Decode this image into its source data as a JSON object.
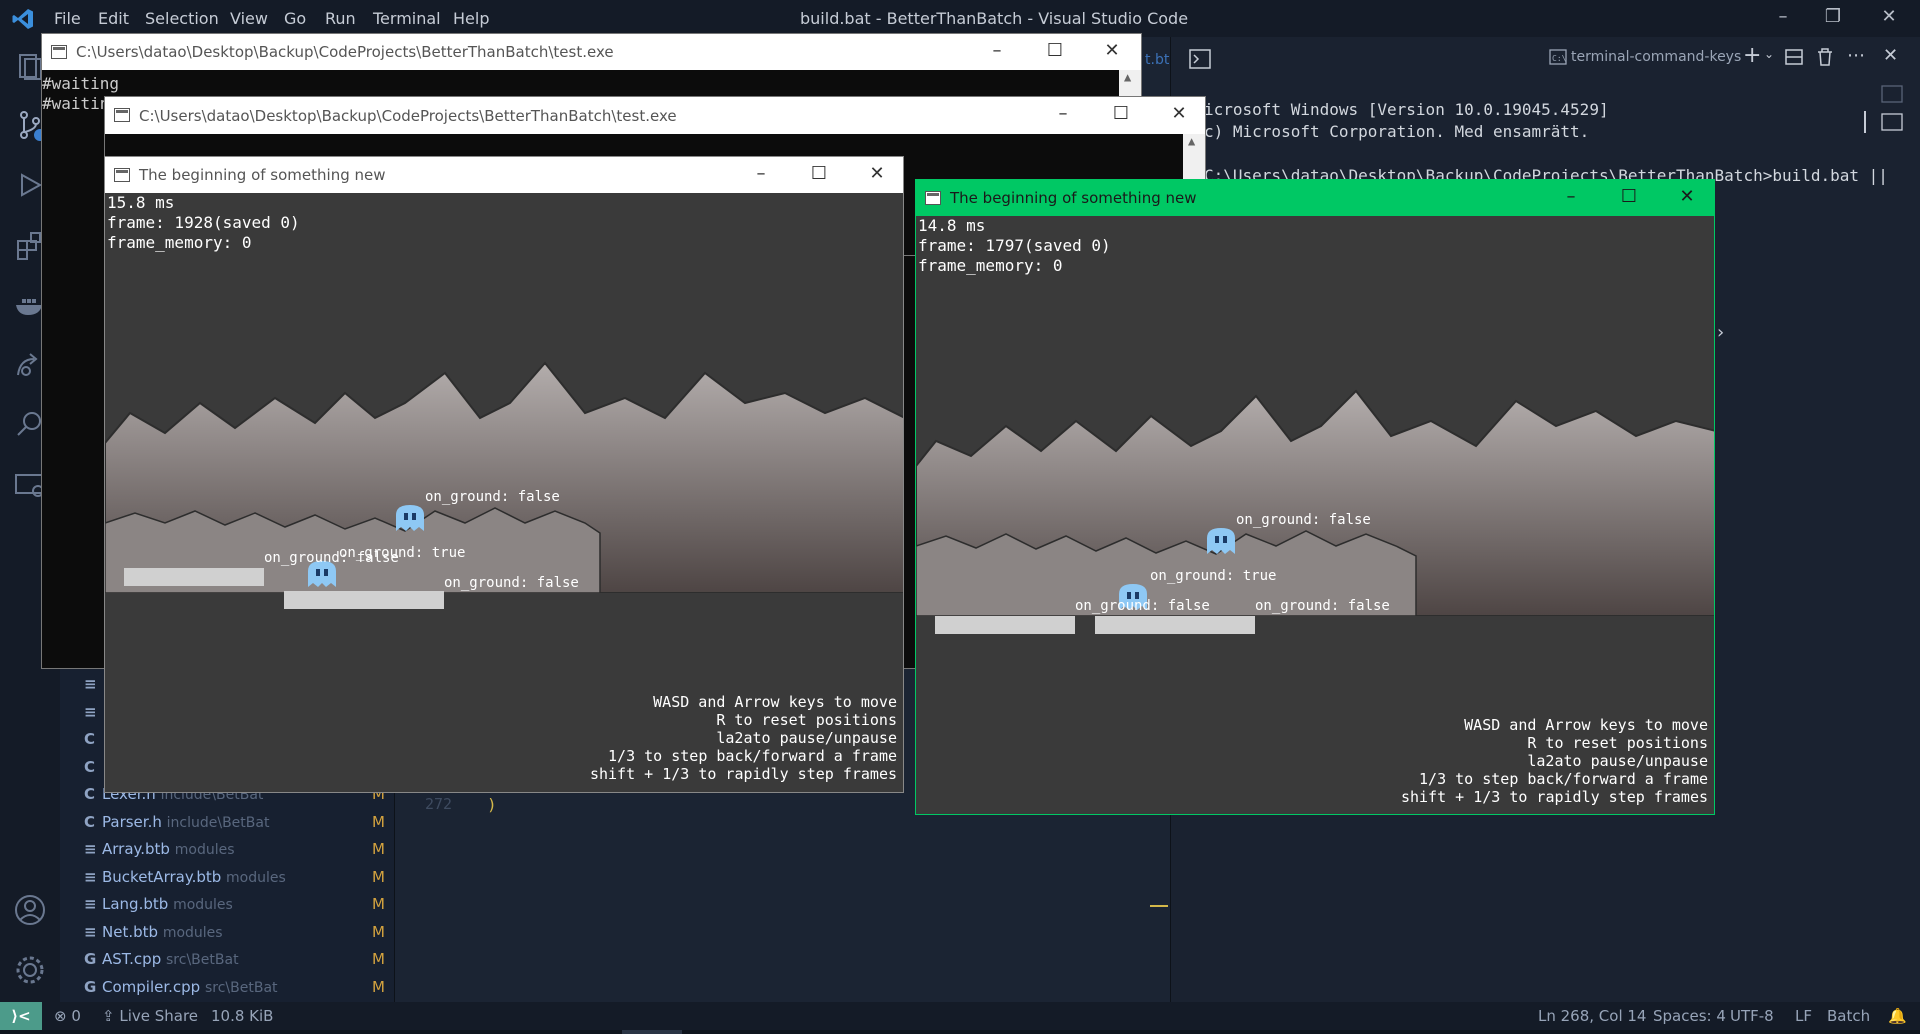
{
  "vscode": {
    "menu": [
      "File",
      "Edit",
      "Selection",
      "View",
      "Go",
      "Run",
      "Terminal",
      "Help"
    ],
    "title": "build.bat - BetterThanBatch - Visual Studio Code",
    "explorer": [
      {
        "icon": "≡",
        "name": "",
        "path": "",
        "mod": ""
      },
      {
        "icon": "≡",
        "name": "",
        "path": "",
        "mod": ""
      },
      {
        "icon": "C",
        "name": "",
        "path": "",
        "mod": ""
      },
      {
        "icon": "C",
        "name": "",
        "path": "",
        "mod": ""
      },
      {
        "icon": "C",
        "name": "Lexer.h",
        "path": "include\\BetBat",
        "mod": "M"
      },
      {
        "icon": "C",
        "name": "Parser.h",
        "path": "include\\BetBat",
        "mod": "M"
      },
      {
        "icon": "≡",
        "name": "Array.btb",
        "path": "modules",
        "mod": "M"
      },
      {
        "icon": "≡",
        "name": "BucketArray.btb",
        "path": "modules",
        "mod": "M"
      },
      {
        "icon": "≡",
        "name": "Lang.btb",
        "path": "modules",
        "mod": "M"
      },
      {
        "icon": "≡",
        "name": "Net.btb",
        "path": "modules",
        "mod": "M"
      },
      {
        "icon": "G",
        "name": "AST.cpp",
        "path": "src\\BetBat",
        "mod": "M"
      },
      {
        "icon": "G",
        "name": "Compiler.cpp",
        "path": "src\\BetBat",
        "mod": "M"
      }
    ],
    "editor": {
      "line_number": "272",
      "line_text": ")",
      "tab_fragment": "t.bt"
    },
    "terminal": {
      "tab_label": "terminal-command-keys",
      "lines": [
        "icrosoft Windows [Version 10.0.19045.4529]",
        "c) Microsoft Corporation. Med ensamrätt.",
        "",
        "C:\\Users\\datao\\Desktop\\Backup\\CodeProjects\\BetterThanBatch>build.bat ||"
      ]
    },
    "status": {
      "remote": "⟩<",
      "problems": "0",
      "live_share": "Live Share",
      "size": "10.8 KiB",
      "position": "Ln 268, Col 14",
      "spaces": "Spaces: 4",
      "encoding": "UTF-8",
      "eol": "LF",
      "language": "Batch"
    }
  },
  "console1": {
    "title": "C:\\Users\\datao\\Desktop\\Backup\\CodeProjects\\BetterThanBatch\\test.exe",
    "lines": [
      "#waiting",
      "#waitin"
    ]
  },
  "console2": {
    "title": "C:\\Users\\datao\\Desktop\\Backup\\CodeProjects\\BetterThanBatch\\test.exe"
  },
  "game1": {
    "title": "The beginning of something new",
    "stats": [
      "15.8 ms",
      "frame: 1928(saved 0)",
      "frame_memory: 0"
    ],
    "labels": [
      "on_ground: false",
      "on_ground: true",
      "on_ground: false",
      "on_ground: false"
    ],
    "help": [
      "WASD and Arrow keys to move",
      "R to reset positions",
      "la2ato pause/unpause",
      "1/3 to step back/forward a frame",
      "shift + 1/3 to rapidly step frames"
    ]
  },
  "game2": {
    "title": "The beginning of something new",
    "stats": [
      "14.8 ms",
      "frame: 1797(saved 0)",
      "frame_memory: 0"
    ],
    "labels": [
      "on_ground: false",
      "on_ground: true",
      "on_ground: false",
      "on_ground: false"
    ],
    "help": [
      "WASD and Arrow keys to move",
      "R to reset positions",
      "la2ato pause/unpause",
      "1/3 to step back/forward a frame",
      "shift + 1/3 to rapidly step frames"
    ]
  },
  "colors": {
    "game2_titlebar": "#00c864",
    "vscode_bg": "#1b2433",
    "status_remote": "#4c9b8a"
  },
  "icons": [
    "vscode-logo-icon",
    "files-icon",
    "source-control-icon",
    "run-debug-icon",
    "extensions-icon",
    "docker-icon",
    "live-share-icon",
    "search-icon",
    "remote-explorer-icon",
    "account-icon",
    "settings-gear-icon",
    "terminal-icon",
    "close-icon",
    "maximize-icon",
    "minimize-icon"
  ]
}
